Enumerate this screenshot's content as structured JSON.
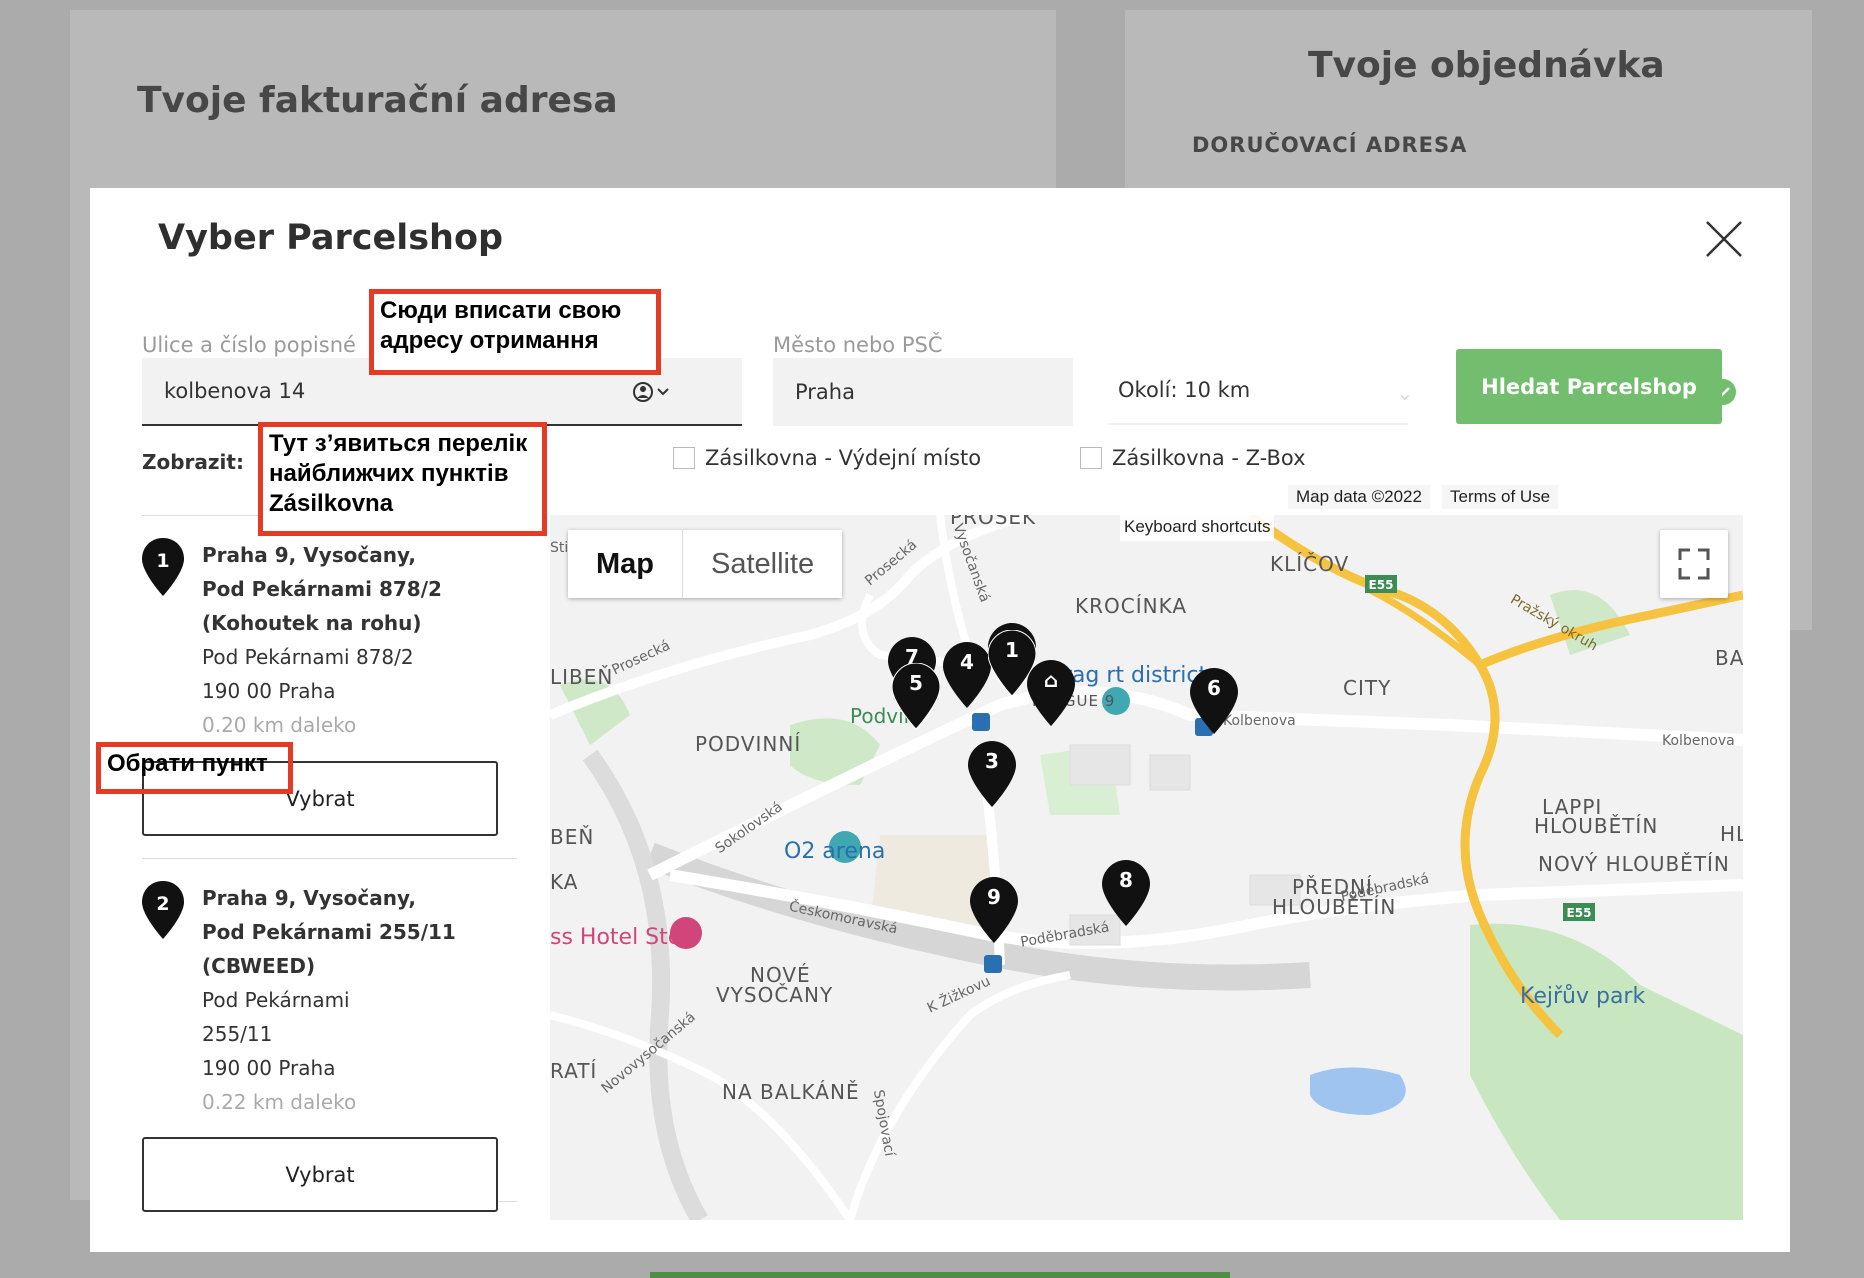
{
  "background": {
    "billing_title": "Tvoje fakturační adresa",
    "order_title": "Tvoje objednávka",
    "delivery_heading": "DORUČOVACÍ ADRESA"
  },
  "modal": {
    "title": "Vyber Parcelshop",
    "street_label": "Ulice a číslo popisné",
    "street_value": "kolbenova 14",
    "city_label": "Město nebo PSČ",
    "city_value": "Praha",
    "radius_value": "Okolí: 10 km",
    "search_button": "Hledat Parcelshop",
    "show_label": "Zobrazit:",
    "filters": [
      "Zásilkovna - Výdejní místo",
      "Zásilkovna - Z-Box"
    ]
  },
  "shops": [
    {
      "number": "1",
      "title_lines": [
        "Praha 9, Vysočany,",
        "Pod Pekárnami 878/2",
        "(Kohoutek na rohu)"
      ],
      "address_lines": [
        "Pod Pekárnami 878/2",
        "190 00 Praha"
      ],
      "distance": "0.20 km daleko",
      "button": "Vybrat"
    },
    {
      "number": "2",
      "title_lines": [
        "Praha 9, Vysočany,",
        "Pod Pekárnami 255/11",
        "(CBWEED)"
      ],
      "address_lines": [
        "Pod Pekárnami",
        "255/11",
        "190 00 Praha"
      ],
      "distance": "0.22 km daleko",
      "button": "Vybrat"
    }
  ],
  "map": {
    "tab_map": "Map",
    "tab_satellite": "Satellite",
    "map_data": "Map data ©2022",
    "terms": "Terms of Use",
    "keyboard_shortcuts": "Keyboard shortcuts",
    "labels": {
      "prosek": "PROSEK",
      "klicov": "KLÍČOV",
      "krocinka": "KROCÍNKA",
      "liben": "LIBEŇ",
      "podvinni_green": "Podviní",
      "podvinni": "PODVINNÍ",
      "prague9": "PRAGUE 9",
      "art_district": "Prag rt district",
      "city": "CITY",
      "kolbenova": "Kolbenova",
      "kolbenova_r": "Kolbenova",
      "lappi": "LAPPI",
      "hloubetin": "HLOUBĚTÍN",
      "novy_hloubetin": "NOVÝ HLOUBĚTÍN",
      "predni": "PŘEDNÍ",
      "predni2": "HLOUBĚTÍN",
      "o2": "O2 arena",
      "hotel": "ss Hotel Step",
      "nove": "NOVÉ",
      "vysocany": "VYSOČANY",
      "balkane": "NA BALKÁNĚ",
      "kejruv": "Kejřův park",
      "prazsky": "Pražský okruh",
      "e55": "E55",
      "e55b": "E55",
      "ba": "BA",
      "hl": "HL",
      "ben": "BEŇ",
      "ka": "KA",
      "rati": "RATÍ",
      "stm": "Sti",
      "prosecka": "Prosecká",
      "prosecka2": "Prosecká",
      "vysocanska": "Vysočanská",
      "sokolovska": "Sokolovská",
      "ceskomoravska": "Českomoravská",
      "podebradska": "Poděbradská",
      "podebradska2": "Poděbradská",
      "zizkovu": "K Žižkovu",
      "novovysocanska": "Novovysočanská",
      "spojovaci": "Spojovací"
    },
    "pins": [
      "7",
      "4",
      "1",
      "5",
      "6",
      "3",
      "9",
      "8"
    ],
    "home_pin": "⌂",
    "colors": {
      "roads": "#ffffff",
      "parks": "#c8e6c0",
      "water": "#9fc4f0",
      "highway": "#f6c341"
    }
  },
  "annotations": {
    "address": "Сюди вписати свою адресу отримання",
    "list": "Тут з’явиться перелік найближчих пунктів Zásilkovna",
    "select": "Обрати пункт"
  }
}
